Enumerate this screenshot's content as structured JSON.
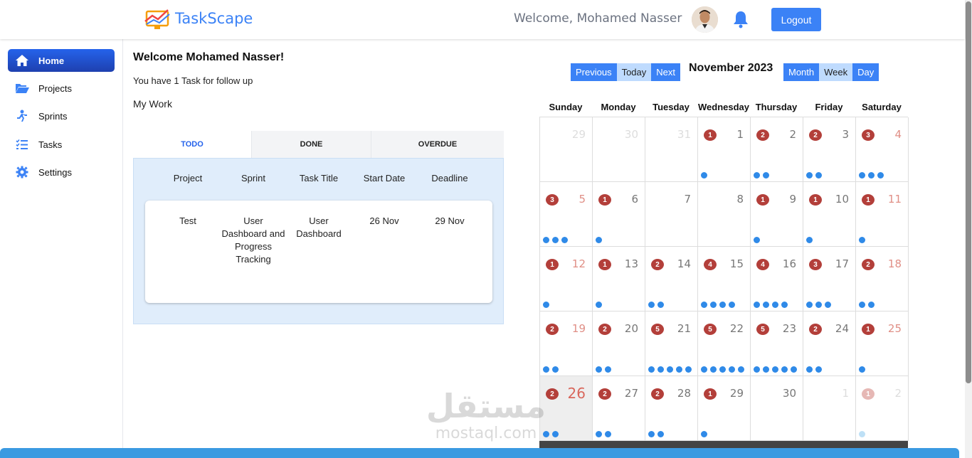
{
  "header": {
    "app_name": "TaskScape",
    "welcome": "Welcome, Mohamed Nasser",
    "logout_label": "Logout"
  },
  "sidebar": {
    "items": [
      {
        "label": "Home",
        "icon": "home-icon",
        "active": true
      },
      {
        "label": "Projects",
        "icon": "folder-open-icon"
      },
      {
        "label": "Sprints",
        "icon": "sprint-icon"
      },
      {
        "label": "Tasks",
        "icon": "task-list-icon"
      },
      {
        "label": "Settings",
        "icon": "gear-icon"
      }
    ]
  },
  "main": {
    "title": "Welcome Mohamed Nasser!",
    "follow_up": "You have 1 Task for follow up",
    "my_work": "My Work",
    "tabs": [
      "TODO",
      "DONE",
      "OVERDUE"
    ],
    "columns": [
      "Project",
      "Sprint",
      "Task Title",
      "Start Date",
      "Deadline"
    ],
    "rows": [
      [
        "Test",
        "User Dashboard and Progress Tracking",
        "User Dashboard",
        "26 Nov",
        "29 Nov"
      ]
    ]
  },
  "calendar": {
    "nav_buttons": [
      "Previous",
      "Today",
      "Next"
    ],
    "view_buttons": [
      "Month",
      "Week",
      "Day"
    ],
    "title": "November 2023",
    "weekdays": [
      "Sunday",
      "Monday",
      "Tuesday",
      "Wednesday",
      "Thursday",
      "Friday",
      "Saturday"
    ],
    "weeks": [
      [
        {
          "day": "29",
          "other": true
        },
        {
          "day": "30",
          "other": true
        },
        {
          "day": "31",
          "other": true
        },
        {
          "day": "1",
          "count": 1,
          "dots": 1
        },
        {
          "day": "2",
          "count": 2,
          "dots": 2
        },
        {
          "day": "3",
          "count": 2,
          "dots": 2
        },
        {
          "day": "4",
          "count": 3,
          "dots": 3
        }
      ],
      [
        {
          "day": "5",
          "count": 3,
          "dots": 3
        },
        {
          "day": "6",
          "count": 1,
          "dots": 1
        },
        {
          "day": "7"
        },
        {
          "day": "8"
        },
        {
          "day": "9",
          "count": 1,
          "dots": 1
        },
        {
          "day": "10",
          "count": 1,
          "dots": 1
        },
        {
          "day": "11",
          "count": 1,
          "dots": 1
        }
      ],
      [
        {
          "day": "12",
          "count": 1,
          "dots": 1
        },
        {
          "day": "13",
          "count": 1,
          "dots": 1
        },
        {
          "day": "14",
          "count": 2,
          "dots": 2
        },
        {
          "day": "15",
          "count": 4,
          "dots": 4
        },
        {
          "day": "16",
          "count": 4,
          "dots": 4
        },
        {
          "day": "17",
          "count": 3,
          "dots": 3
        },
        {
          "day": "18",
          "count": 2,
          "dots": 2
        }
      ],
      [
        {
          "day": "19",
          "count": 2,
          "dots": 2
        },
        {
          "day": "20",
          "count": 2,
          "dots": 2
        },
        {
          "day": "21",
          "count": 5,
          "dots": 5
        },
        {
          "day": "22",
          "count": 5,
          "dots": 5
        },
        {
          "day": "23",
          "count": 5,
          "dots": 5
        },
        {
          "day": "24",
          "count": 2,
          "dots": 2
        },
        {
          "day": "25",
          "count": 1,
          "dots": 1
        }
      ],
      [
        {
          "day": "26",
          "count": 2,
          "dots": 2,
          "today": true
        },
        {
          "day": "27",
          "count": 2,
          "dots": 2
        },
        {
          "day": "28",
          "count": 2,
          "dots": 2
        },
        {
          "day": "29",
          "count": 1,
          "dots": 1
        },
        {
          "day": "30"
        },
        {
          "day": "1",
          "other": true
        },
        {
          "day": "2",
          "other": true,
          "count": 1,
          "dots": 1
        }
      ]
    ]
  },
  "watermark": {
    "arabic": "مستقل",
    "latin": "mostaql.com"
  },
  "colors": {
    "primary": "#3b82f6",
    "badge": "#b33f3a",
    "dot": "#2f8ae8",
    "panel": "#e0edfb",
    "footer": "#3b9ae1"
  }
}
